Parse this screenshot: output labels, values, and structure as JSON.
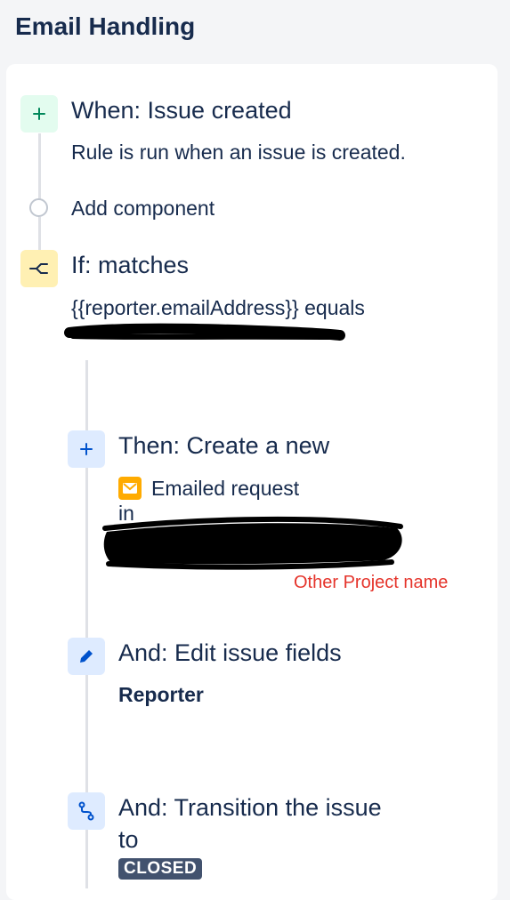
{
  "page_title": "Email Handling",
  "trigger": {
    "heading": "When: Issue created",
    "description": "Rule is run when an issue is created.",
    "icon": "plus-icon"
  },
  "add_component": {
    "label": "Add component"
  },
  "condition": {
    "heading": "If: matches",
    "expression": "{{reporter.emailAddress}} equals",
    "icon": "branch-icon"
  },
  "action_create": {
    "heading": "Then: Create a new",
    "request_type": "Emailed request",
    "in_label": "in",
    "icon": "plus-icon",
    "request_icon": "mail-icon"
  },
  "annotation": {
    "text": "Other Project name",
    "color": "#e5342b"
  },
  "action_edit": {
    "heading": "And: Edit issue fields",
    "field": "Reporter",
    "icon": "pencil-icon"
  },
  "action_transition": {
    "heading_line1": "And: Transition the issue",
    "heading_line2": "to",
    "status": "CLOSED",
    "icon": "transition-icon"
  },
  "colors": {
    "trigger_bg": "#e3fcef",
    "trigger_fg": "#00875a",
    "condition_bg": "#fff0b3",
    "action_bg": "#deebff",
    "action_fg": "#0052cc",
    "mail_icon": "#ffab00",
    "status_badge": "#42526e"
  }
}
